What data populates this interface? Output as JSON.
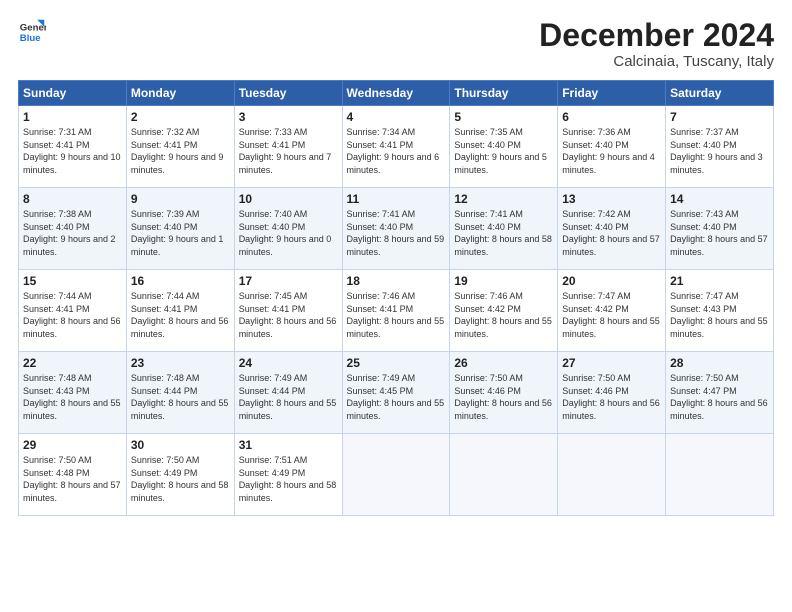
{
  "logo": {
    "line1": "General",
    "line2": "Blue"
  },
  "title": "December 2024",
  "subtitle": "Calcinaia, Tuscany, Italy",
  "days": [
    "Sunday",
    "Monday",
    "Tuesday",
    "Wednesday",
    "Thursday",
    "Friday",
    "Saturday"
  ],
  "weeks": [
    [
      {
        "num": "1",
        "rise": "7:31 AM",
        "set": "4:41 PM",
        "daylight": "9 hours and 10 minutes."
      },
      {
        "num": "2",
        "rise": "7:32 AM",
        "set": "4:41 PM",
        "daylight": "9 hours and 9 minutes."
      },
      {
        "num": "3",
        "rise": "7:33 AM",
        "set": "4:41 PM",
        "daylight": "9 hours and 7 minutes."
      },
      {
        "num": "4",
        "rise": "7:34 AM",
        "set": "4:41 PM",
        "daylight": "9 hours and 6 minutes."
      },
      {
        "num": "5",
        "rise": "7:35 AM",
        "set": "4:40 PM",
        "daylight": "9 hours and 5 minutes."
      },
      {
        "num": "6",
        "rise": "7:36 AM",
        "set": "4:40 PM",
        "daylight": "9 hours and 4 minutes."
      },
      {
        "num": "7",
        "rise": "7:37 AM",
        "set": "4:40 PM",
        "daylight": "9 hours and 3 minutes."
      }
    ],
    [
      {
        "num": "8",
        "rise": "7:38 AM",
        "set": "4:40 PM",
        "daylight": "9 hours and 2 minutes."
      },
      {
        "num": "9",
        "rise": "7:39 AM",
        "set": "4:40 PM",
        "daylight": "9 hours and 1 minute."
      },
      {
        "num": "10",
        "rise": "7:40 AM",
        "set": "4:40 PM",
        "daylight": "9 hours and 0 minutes."
      },
      {
        "num": "11",
        "rise": "7:41 AM",
        "set": "4:40 PM",
        "daylight": "8 hours and 59 minutes."
      },
      {
        "num": "12",
        "rise": "7:41 AM",
        "set": "4:40 PM",
        "daylight": "8 hours and 58 minutes."
      },
      {
        "num": "13",
        "rise": "7:42 AM",
        "set": "4:40 PM",
        "daylight": "8 hours and 57 minutes."
      },
      {
        "num": "14",
        "rise": "7:43 AM",
        "set": "4:40 PM",
        "daylight": "8 hours and 57 minutes."
      }
    ],
    [
      {
        "num": "15",
        "rise": "7:44 AM",
        "set": "4:41 PM",
        "daylight": "8 hours and 56 minutes."
      },
      {
        "num": "16",
        "rise": "7:44 AM",
        "set": "4:41 PM",
        "daylight": "8 hours and 56 minutes."
      },
      {
        "num": "17",
        "rise": "7:45 AM",
        "set": "4:41 PM",
        "daylight": "8 hours and 56 minutes."
      },
      {
        "num": "18",
        "rise": "7:46 AM",
        "set": "4:41 PM",
        "daylight": "8 hours and 55 minutes."
      },
      {
        "num": "19",
        "rise": "7:46 AM",
        "set": "4:42 PM",
        "daylight": "8 hours and 55 minutes."
      },
      {
        "num": "20",
        "rise": "7:47 AM",
        "set": "4:42 PM",
        "daylight": "8 hours and 55 minutes."
      },
      {
        "num": "21",
        "rise": "7:47 AM",
        "set": "4:43 PM",
        "daylight": "8 hours and 55 minutes."
      }
    ],
    [
      {
        "num": "22",
        "rise": "7:48 AM",
        "set": "4:43 PM",
        "daylight": "8 hours and 55 minutes."
      },
      {
        "num": "23",
        "rise": "7:48 AM",
        "set": "4:44 PM",
        "daylight": "8 hours and 55 minutes."
      },
      {
        "num": "24",
        "rise": "7:49 AM",
        "set": "4:44 PM",
        "daylight": "8 hours and 55 minutes."
      },
      {
        "num": "25",
        "rise": "7:49 AM",
        "set": "4:45 PM",
        "daylight": "8 hours and 55 minutes."
      },
      {
        "num": "26",
        "rise": "7:50 AM",
        "set": "4:46 PM",
        "daylight": "8 hours and 56 minutes."
      },
      {
        "num": "27",
        "rise": "7:50 AM",
        "set": "4:46 PM",
        "daylight": "8 hours and 56 minutes."
      },
      {
        "num": "28",
        "rise": "7:50 AM",
        "set": "4:47 PM",
        "daylight": "8 hours and 56 minutes."
      }
    ],
    [
      {
        "num": "29",
        "rise": "7:50 AM",
        "set": "4:48 PM",
        "daylight": "8 hours and 57 minutes."
      },
      {
        "num": "30",
        "rise": "7:50 AM",
        "set": "4:49 PM",
        "daylight": "8 hours and 58 minutes."
      },
      {
        "num": "31",
        "rise": "7:51 AM",
        "set": "4:49 PM",
        "daylight": "8 hours and 58 minutes."
      },
      null,
      null,
      null,
      null
    ]
  ]
}
